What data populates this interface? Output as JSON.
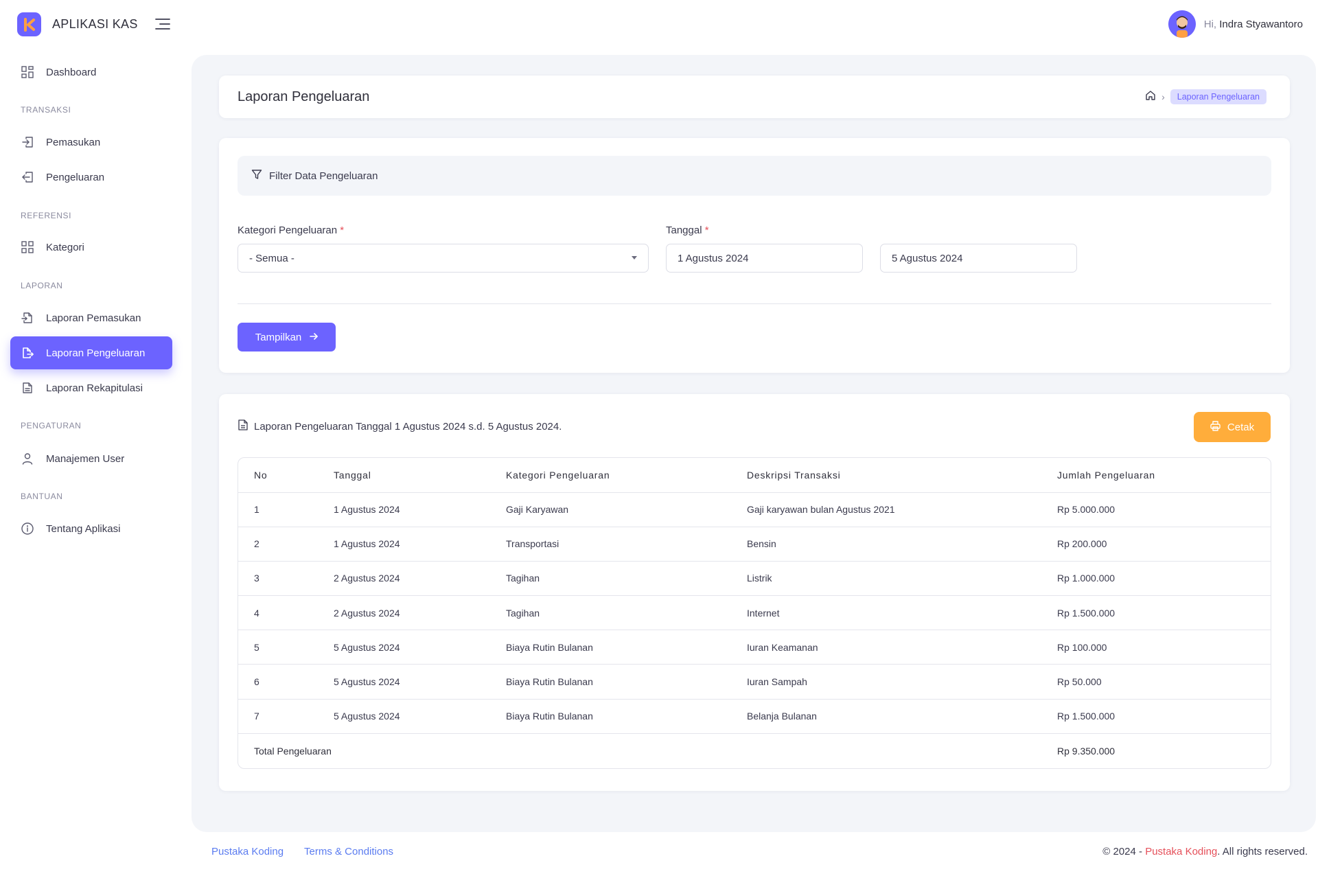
{
  "app": {
    "name": "APLIKASI KAS",
    "brand_color": "#6c63ff"
  },
  "user": {
    "greeting": "Hi,",
    "name": "Indra Styawantoro"
  },
  "sidebar": {
    "dashboard": {
      "label": "Dashboard",
      "icon": "grid-icon"
    },
    "heading_transaksi": "TRANSAKSI",
    "pemasukan": {
      "label": "Pemasukan",
      "icon": "login-icon"
    },
    "pengeluaran": {
      "label": "Pengeluaran",
      "icon": "logout-icon"
    },
    "heading_referensi": "REFERENSI",
    "kategori": {
      "label": "Kategori",
      "icon": "grid-icon"
    },
    "heading_laporan": "LAPORAN",
    "laporan_pemasukan": {
      "label": "Laporan Pemasukan",
      "icon": "file-import-icon"
    },
    "laporan_pengeluaran": {
      "label": "Laporan Pengeluaran",
      "icon": "file-export-icon",
      "active": true
    },
    "laporan_rekapitulasi": {
      "label": "Laporan Rekapitulasi",
      "icon": "file-text-icon"
    },
    "heading_pengaturan": "PENGATURAN",
    "manajemen_user": {
      "label": "Manajemen User",
      "icon": "user-icon"
    },
    "heading_bantuan": "BANTUAN",
    "tentang_aplikasi": {
      "label": "Tentang Aplikasi",
      "icon": "info-icon"
    }
  },
  "page": {
    "title": "Laporan Pengeluaran",
    "breadcrumb_current": "Laporan Pengeluaran"
  },
  "filter": {
    "title": "Filter Data Pengeluaran",
    "kategori_label": "Kategori Pengeluaran",
    "kategori_value": "- Semua -",
    "tanggal_label": "Tanggal",
    "required_mark": "*",
    "tanggal_awal": "1 Agustus 2024",
    "tanggal_akhir": "5 Agustus 2024",
    "submit_label": "Tampilkan"
  },
  "report": {
    "title": "Laporan Pengeluaran Tanggal 1 Agustus 2024 s.d. 5 Agustus 2024.",
    "print_label": "Cetak",
    "columns": [
      "No",
      "Tanggal",
      "Kategori Pengeluaran",
      "Deskripsi Transaksi",
      "Jumlah Pengeluaran"
    ],
    "rows": [
      [
        "1",
        "1 Agustus 2024",
        "Gaji Karyawan",
        "Gaji karyawan bulan Agustus 2021",
        "Rp 5.000.000"
      ],
      [
        "2",
        "1 Agustus 2024",
        "Transportasi",
        "Bensin",
        "Rp 200.000"
      ],
      [
        "3",
        "2 Agustus 2024",
        "Tagihan",
        "Listrik",
        "Rp 1.000.000"
      ],
      [
        "4",
        "2 Agustus 2024",
        "Tagihan",
        "Internet",
        "Rp 1.500.000"
      ],
      [
        "5",
        "5 Agustus 2024",
        "Biaya Rutin Bulanan",
        "Iuran Keamanan",
        "Rp 100.000"
      ],
      [
        "6",
        "5 Agustus 2024",
        "Biaya Rutin Bulanan",
        "Iuran Sampah",
        "Rp 50.000"
      ],
      [
        "7",
        "5 Agustus 2024",
        "Biaya Rutin Bulanan",
        "Belanja Bulanan",
        "Rp 1.500.000"
      ]
    ],
    "total_label": "Total Pengeluaran",
    "total_value": "Rp 9.350.000"
  },
  "footer": {
    "link1": "Pustaka Koding",
    "link2": "Terms & Conditions",
    "copyright_prefix": "© 2024 -",
    "copyright_brand": "Pustaka Koding",
    "copyright_suffix": ". All rights reserved."
  }
}
